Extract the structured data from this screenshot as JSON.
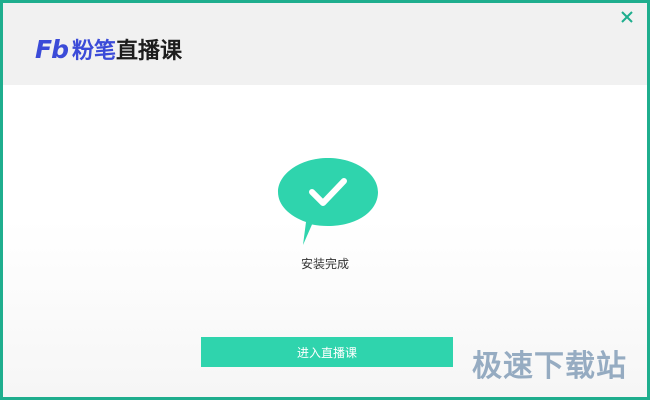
{
  "app": {
    "logo_mark": "Fb",
    "brand": "粉笔",
    "product": "直播课"
  },
  "window": {
    "close_symbol": "✕"
  },
  "status": {
    "icon": "check-chat-bubble-icon",
    "text": "安装完成"
  },
  "actions": {
    "enter_label": "进入直播课"
  },
  "watermark": {
    "text": "极速下载站"
  },
  "colors": {
    "accent": "#2fd4ad",
    "border": "#1fae8e",
    "brand": "#3b4bd8"
  }
}
